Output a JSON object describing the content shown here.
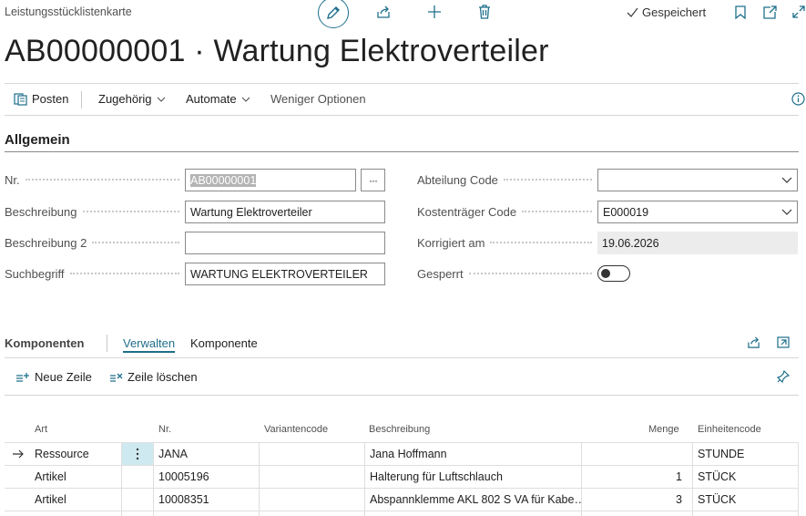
{
  "header": {
    "page_type": "Leistungsstücklistenkarte",
    "saved_label": "Gespeichert",
    "title": "AB00000001 · Wartung Elektroverteiler"
  },
  "actions": {
    "posten": "Posten",
    "zugehoerig": "Zugehörig",
    "automate": "Automate",
    "weniger": "Weniger Optionen"
  },
  "general": {
    "section_title": "Allgemein",
    "fields": {
      "nr": {
        "label": "Nr.",
        "value": "AB00000001"
      },
      "beschreibung": {
        "label": "Beschreibung",
        "value": "Wartung Elektroverteiler"
      },
      "beschreibung2": {
        "label": "Beschreibung 2",
        "value": ""
      },
      "suchbegriff": {
        "label": "Suchbegriff",
        "value": "WARTUNG ELEKTROVERTEILER"
      },
      "abteilung": {
        "label": "Abteilung Code",
        "value": ""
      },
      "kostentraeger": {
        "label": "Kostenträger Code",
        "value": "E000019"
      },
      "korrigiert": {
        "label": "Korrigiert am",
        "value": "19.06.2026"
      },
      "gesperrt": {
        "label": "Gesperrt",
        "value": "off"
      }
    },
    "more_button": "···"
  },
  "part": {
    "title": "Komponenten",
    "tabs": [
      "Verwalten",
      "Komponente"
    ],
    "new_line": "Neue Zeile",
    "delete_line": "Zeile löschen",
    "columns": {
      "art": "Art",
      "nr": "Nr.",
      "variante": "Variantencode",
      "beschreibung": "Beschreibung",
      "menge": "Menge",
      "einheit": "Einheitencode"
    },
    "rows": [
      {
        "art": "Ressource",
        "nr": "JANA",
        "variante": "",
        "beschreibung": "Jana Hoffmann",
        "menge": "",
        "einheit": "STUNDE"
      },
      {
        "art": "Artikel",
        "nr": "10005196",
        "variante": "",
        "beschreibung": "Halterung für Luftschlauch",
        "menge": "1",
        "einheit": "STÜCK"
      },
      {
        "art": "Artikel",
        "nr": "10008351",
        "variante": "",
        "beschreibung": "Abspannklemme AKL 802 S VA für Kabe…",
        "menge": "3",
        "einheit": "STÜCK"
      }
    ]
  },
  "colors": {
    "accent": "#1f6f8b",
    "row_menu_bg": "#cfe9f0"
  }
}
